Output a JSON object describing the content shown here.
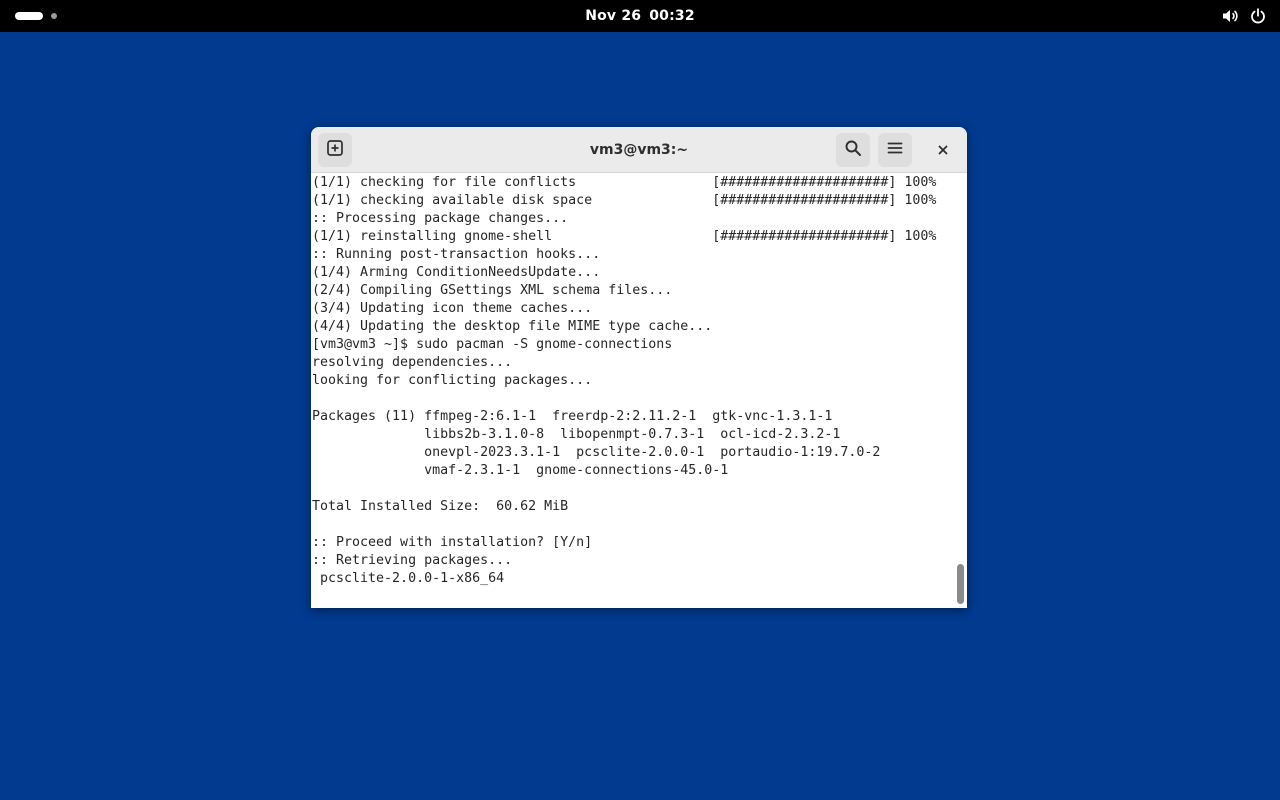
{
  "topbar": {
    "date": "Nov 26",
    "time": "00:32",
    "icons": [
      "workspace-indicator",
      "volume-icon",
      "power-icon"
    ]
  },
  "window": {
    "title": "vm3@vm3:~",
    "buttons": [
      "new-tab-icon",
      "search-icon",
      "menu-icon",
      "close-icon"
    ]
  },
  "terminal": {
    "lines": [
      "(1/1) checking for file conflicts                 [#####################] 100%",
      "(1/1) checking available disk space               [#####################] 100%",
      ":: Processing package changes...",
      "(1/1) reinstalling gnome-shell                    [#####################] 100%",
      ":: Running post-transaction hooks...",
      "(1/4) Arming ConditionNeedsUpdate...",
      "(2/4) Compiling GSettings XML schema files...",
      "(3/4) Updating icon theme caches...",
      "(4/4) Updating the desktop file MIME type cache...",
      "[vm3@vm3 ~]$ sudo pacman -S gnome-connections",
      "resolving dependencies...",
      "looking for conflicting packages...",
      "",
      "Packages (11) ffmpeg-2:6.1-1  freerdp-2:2.11.2-1  gtk-vnc-1.3.1-1",
      "              libbs2b-3.1.0-8  libopenmpt-0.7.3-1  ocl-icd-2.3.2-1",
      "              onevpl-2023.3.1-1  pcsclite-2.0.0-1  portaudio-1:19.7.0-2",
      "              vmaf-2.3.1-1  gnome-connections-45.0-1",
      "",
      "Total Installed Size:  60.62 MiB",
      "",
      ":: Proceed with installation? [Y/n]",
      ":: Retrieving packages...",
      " pcsclite-2.0.0-1-x86_64"
    ]
  },
  "colors": {
    "desktop": "#013a8f",
    "topbar": "#000000",
    "headerbar": "#ebebeb",
    "terminal_bg": "#ffffff",
    "terminal_fg": "#262626"
  }
}
